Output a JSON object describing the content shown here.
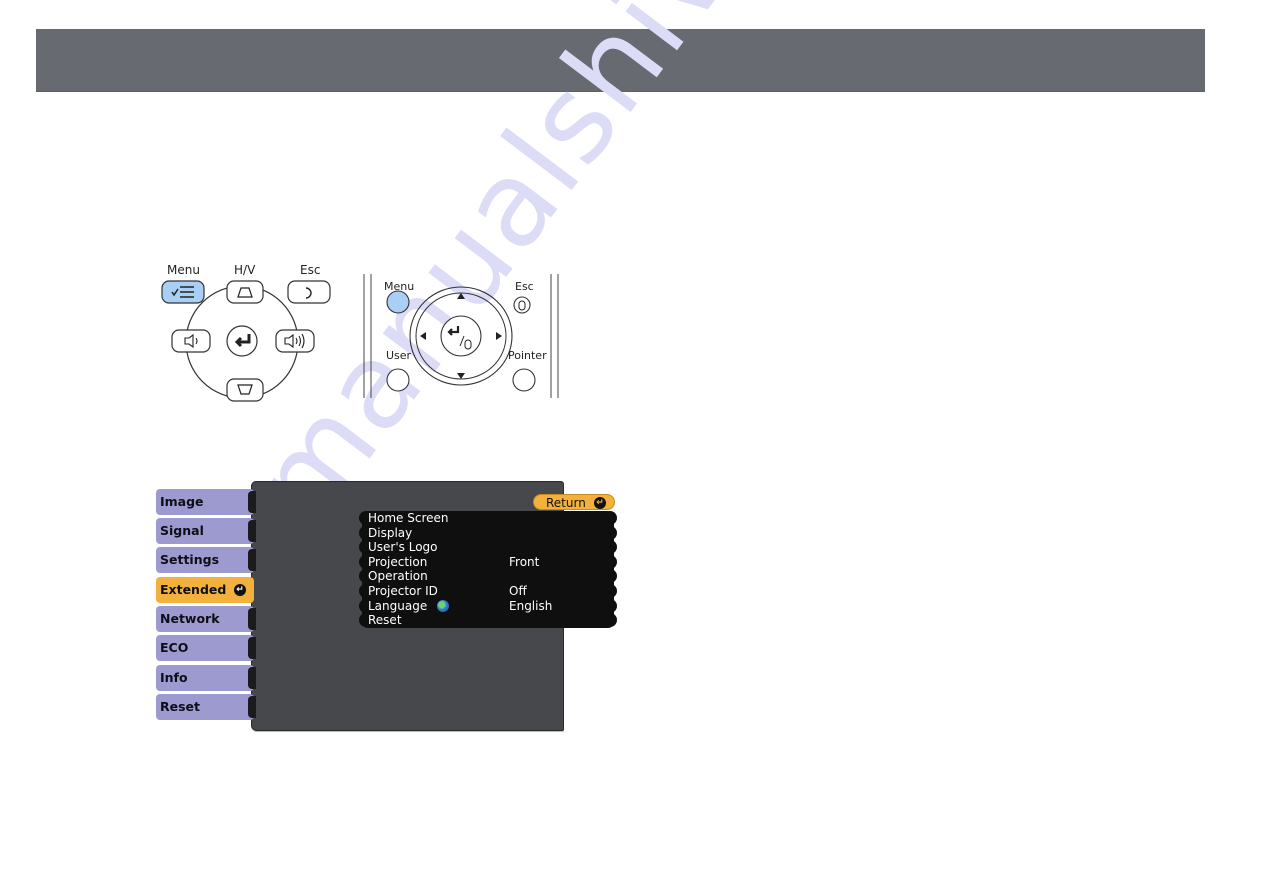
{
  "header": {
    "title": ""
  },
  "watermark": {
    "text": "manualshive.com"
  },
  "control_panel": {
    "labels": {
      "menu": "Menu",
      "hv": "H/V",
      "esc": "Esc"
    },
    "buttons": [
      "menu",
      "hv-keystone-up",
      "esc",
      "volume-down",
      "enter",
      "volume-up",
      "hv-keystone-down"
    ],
    "highlight_color": "#a9cff5"
  },
  "remote": {
    "labels": {
      "menu": "Menu",
      "esc": "Esc",
      "user": "User",
      "pointer": "Pointer"
    },
    "highlight_color": "#a9cff5"
  },
  "projector_menu": {
    "tabs": [
      {
        "label": "Image",
        "active": false
      },
      {
        "label": "Signal",
        "active": false
      },
      {
        "label": "Settings",
        "active": false
      },
      {
        "label": "Extended",
        "active": true
      },
      {
        "label": "Network",
        "active": false
      },
      {
        "label": "ECO",
        "active": false
      },
      {
        "label": "Info",
        "active": false
      },
      {
        "label": "Reset",
        "active": false
      }
    ],
    "return_label": "Return",
    "items": [
      {
        "name": "Home Screen",
        "value": ""
      },
      {
        "name": "Display",
        "value": ""
      },
      {
        "name": "User's Logo",
        "value": ""
      },
      {
        "name": "Projection",
        "value": "Front"
      },
      {
        "name": "Operation",
        "value": ""
      },
      {
        "name": "Projector ID",
        "value": "Off"
      },
      {
        "name": "Language",
        "value": "English",
        "icon": "globe-icon"
      },
      {
        "name": "Reset",
        "value": ""
      }
    ],
    "colors": {
      "tab": "#9d9ad0",
      "active_tab": "#f2b13c",
      "panel": "#47484c",
      "list": "#0f0f10"
    }
  }
}
